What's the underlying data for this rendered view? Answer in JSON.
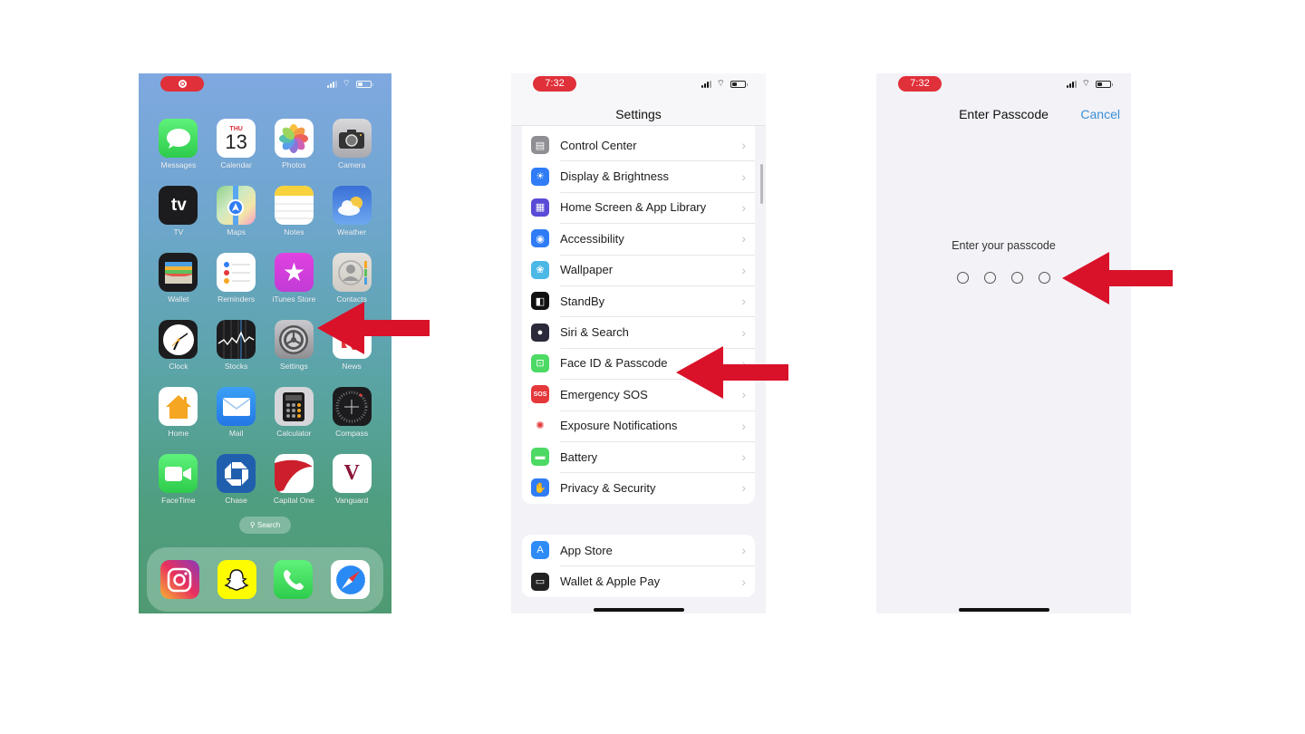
{
  "colors": {
    "arrow": "#d9122a",
    "status_pill": "#e0303a",
    "ios_blue": "#3a8fd6",
    "settings_bg": "#f2f2f7"
  },
  "home_screen": {
    "status": {
      "recording_indicator": "record-icon"
    },
    "apps": [
      {
        "label": "Messages",
        "icon": "messages-icon"
      },
      {
        "label": "Calendar",
        "icon": "calendar-icon",
        "day_name": "THU",
        "day_number": "13"
      },
      {
        "label": "Photos",
        "icon": "photos-icon"
      },
      {
        "label": "Camera",
        "icon": "camera-icon"
      },
      {
        "label": "TV",
        "icon": "apple-tv-icon",
        "glyph": "tv"
      },
      {
        "label": "Maps",
        "icon": "maps-icon"
      },
      {
        "label": "Notes",
        "icon": "notes-icon"
      },
      {
        "label": "Weather",
        "icon": "weather-icon"
      },
      {
        "label": "Wallet",
        "icon": "wallet-icon"
      },
      {
        "label": "Reminders",
        "icon": "reminders-icon"
      },
      {
        "label": "iTunes Store",
        "icon": "itunes-store-icon"
      },
      {
        "label": "Contacts",
        "icon": "contacts-icon"
      },
      {
        "label": "Clock",
        "icon": "clock-icon"
      },
      {
        "label": "Stocks",
        "icon": "stocks-icon"
      },
      {
        "label": "Settings",
        "icon": "settings-gear-icon"
      },
      {
        "label": "News",
        "icon": "news-icon"
      },
      {
        "label": "Home",
        "icon": "home-app-icon"
      },
      {
        "label": "Mail",
        "icon": "mail-icon"
      },
      {
        "label": "Calculator",
        "icon": "calculator-icon"
      },
      {
        "label": "Compass",
        "icon": "compass-icon"
      },
      {
        "label": "FaceTime",
        "icon": "facetime-icon"
      },
      {
        "label": "Chase",
        "icon": "chase-icon"
      },
      {
        "label": "Capital One",
        "icon": "capital-one-icon"
      },
      {
        "label": "Vanguard",
        "icon": "vanguard-icon",
        "glyph": "V"
      }
    ],
    "search_label": "Search",
    "dock": [
      {
        "name": "Instagram",
        "icon": "instagram-icon"
      },
      {
        "name": "Snapchat",
        "icon": "snapchat-icon"
      },
      {
        "name": "Phone",
        "icon": "phone-icon"
      },
      {
        "name": "Safari",
        "icon": "safari-icon"
      }
    ]
  },
  "settings_screen": {
    "status_time": "7:32",
    "title": "Settings",
    "main_group": [
      {
        "label": "Control Center",
        "icon": "control-center-icon",
        "color": "#8e8e93"
      },
      {
        "label": "Display & Brightness",
        "icon": "display-brightness-icon",
        "color": "#2f7cf6"
      },
      {
        "label": "Home Screen & App Library",
        "icon": "home-screen-icon",
        "color": "#5a4bd6"
      },
      {
        "label": "Accessibility",
        "icon": "accessibility-icon",
        "color": "#2f7cf6"
      },
      {
        "label": "Wallpaper",
        "icon": "wallpaper-icon",
        "color": "#4bb8e6"
      },
      {
        "label": "StandBy",
        "icon": "standby-icon",
        "color": "#111111"
      },
      {
        "label": "Siri & Search",
        "icon": "siri-icon",
        "color": "#2a2a3a"
      },
      {
        "label": "Face ID & Passcode",
        "icon": "face-id-icon",
        "color": "#4cd964"
      },
      {
        "label": "Emergency SOS",
        "icon": "sos-icon",
        "color": "#e5383b",
        "glyph": "SOS"
      },
      {
        "label": "Exposure Notifications",
        "icon": "exposure-notifications-icon",
        "color": "#ffffff"
      },
      {
        "label": "Battery",
        "icon": "battery-icon",
        "color": "#4cd964"
      },
      {
        "label": "Privacy & Security",
        "icon": "privacy-hand-icon",
        "color": "#2f7cf6"
      }
    ],
    "store_group": [
      {
        "label": "App Store",
        "icon": "app-store-icon",
        "color": "#2f8cf6"
      },
      {
        "label": "Wallet & Apple Pay",
        "icon": "wallet-apple-pay-icon",
        "color": "#222222"
      }
    ]
  },
  "passcode_screen": {
    "status_time": "7:32",
    "title": "Enter Passcode",
    "cancel_label": "Cancel",
    "prompt": "Enter your passcode",
    "digits_entered": 0,
    "digits_total": 4
  },
  "annotations": [
    {
      "target": "Settings app",
      "icon": "left-arrow-icon"
    },
    {
      "target": "Face ID & Passcode",
      "icon": "left-arrow-icon"
    },
    {
      "target": "Passcode dots",
      "icon": "left-arrow-icon"
    }
  ]
}
